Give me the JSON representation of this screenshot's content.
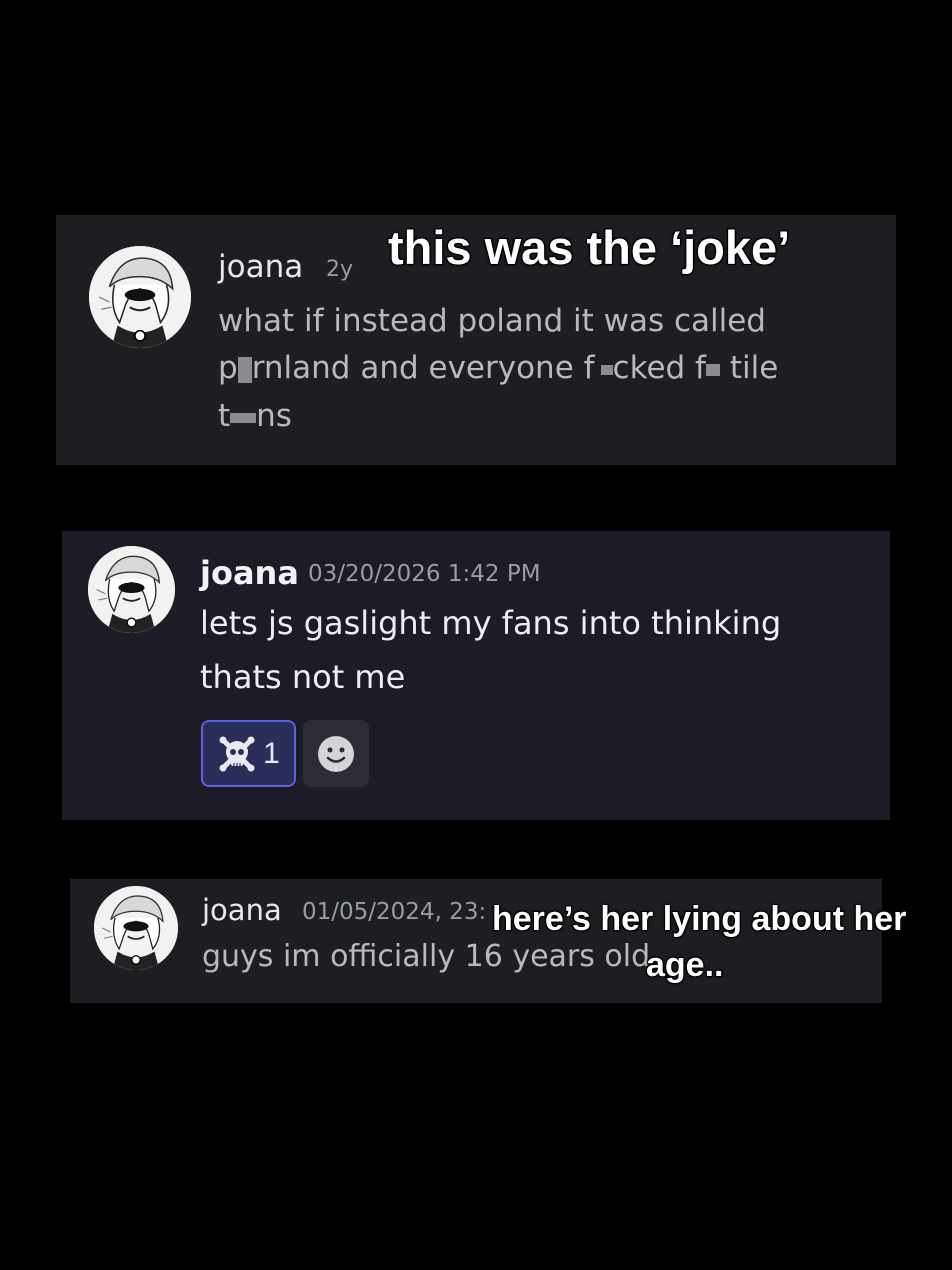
{
  "messages": [
    {
      "username": "joana",
      "timestamp": "2y",
      "line1": "what if instead poland it was called",
      "line2": {
        "part_a": "p",
        "part_b": "rnland and everyone f",
        "part_c": "cked f",
        "part_d": " tile"
      },
      "line3": {
        "part_a": "t",
        "part_b": "ns"
      }
    },
    {
      "username": "joana",
      "timestamp": "03/20/2026 1:42 PM",
      "line1": "lets js gaslight my fans into thinking",
      "line2": "thats not me",
      "reactions": [
        {
          "icon": "skull-crossbones-icon",
          "count": "1",
          "selected": true
        }
      ],
      "add_reaction_icon": "smiley-icon"
    },
    {
      "username": "joana",
      "timestamp": "01/05/2024, 23:",
      "line1": "guys im officially 16 years old"
    }
  ],
  "captions": {
    "top": "this was the ‘joke’",
    "bottom_line1": "here’s her lying about her",
    "bottom_line2": "age.."
  },
  "colors": {
    "background": "#000000",
    "card": "#1d1e22",
    "card_alt": "#1c1b26",
    "reaction_selected_bg": "#2b2d5a",
    "reaction_selected_border": "#5b63e0"
  }
}
